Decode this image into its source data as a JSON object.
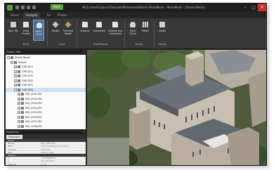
{
  "window": {
    "title": "W:\\ContextCapture\\Tutorials\\Photomesh\\Demo.PhotoMesh - PhotoMesh - [Street Model]",
    "ribbon_badge": "Build",
    "minimize": "–",
    "maximize": "□",
    "close": "×"
  },
  "tabs": [
    "Home",
    "Analysis",
    "Tie",
    "Photos"
  ],
  "ribbon": {
    "buttons": [
      {
        "label": "New Tile",
        "icon": "new-tile-icon"
      },
      {
        "label": "Build Project",
        "icon": "build-project-icon"
      },
      {
        "label": "Build Cloud",
        "icon": "build-cloud-icon",
        "active": true
      },
      {
        "label": "Model",
        "icon": "model-icon"
      },
      {
        "label": "Textured Model",
        "icon": "textured-model-icon"
      },
      {
        "label": "Original",
        "icon": "original-icon"
      },
      {
        "label": "Calculated",
        "icon": "calculated-icon"
      },
      {
        "label": "Original and Calculated",
        "icon": "original-calculated-icon"
      },
      {
        "label": "Point Cloud",
        "icon": "point-cloud-icon"
      },
      {
        "label": "Model",
        "icon": "export-model-icon"
      },
      {
        "label": "Model",
        "icon": "upload-model-icon"
      }
    ],
    "groups": [
      "Build",
      "Show",
      "Show Photos",
      "Export",
      "Upload"
    ]
  },
  "project_tree": {
    "header": "Project Tree",
    "close": "×",
    "items": [
      {
        "label": "Street Model",
        "level": 0,
        "expand": "-"
      },
      {
        "label": "Photos",
        "level": 1,
        "expand": "-"
      },
      {
        "label": "CAM [01]",
        "level": 2,
        "expand": "+"
      },
      {
        "label": "CAM [02]",
        "level": 2,
        "expand": "+"
      },
      {
        "label": "CAM [03]",
        "level": 2,
        "expand": "+"
      },
      {
        "label": "CAM [04]",
        "level": 2,
        "expand": "+"
      },
      {
        "label": "CAM [05]",
        "level": 2,
        "expand": "+"
      },
      {
        "label": "CAM [06]",
        "level": 2,
        "expand": "-",
        "selected": true
      },
      {
        "label": "IMG_0001.JPG",
        "level": 3,
        "expand": "+"
      },
      {
        "label": "IMG_0002.JPG",
        "level": 3,
        "expand": "+"
      },
      {
        "label": "IMG_0003.JPG",
        "level": 3,
        "expand": "+"
      },
      {
        "label": "IMG_0004.JPG",
        "level": 3,
        "expand": "+"
      },
      {
        "label": "IMG_0005.JPG",
        "level": 3,
        "expand": "+"
      },
      {
        "label": "IMG_0006.JPG",
        "level": 3,
        "expand": "+"
      },
      {
        "label": "IMG_0007.JPG",
        "level": 3,
        "expand": "+"
      },
      {
        "label": "IMG_0008.JPG",
        "level": 3,
        "expand": "+"
      }
    ]
  },
  "properties": {
    "header": "Properties",
    "close": "×",
    "tab": "Properties",
    "rows": [
      {
        "key": "Photo",
        "value": "",
        "section": true
      },
      {
        "key": "Name",
        "value": "IMG_0006.JPG"
      },
      {
        "key": "Path",
        "value": "W:\\ContextCapture\\Photos"
      },
      {
        "key": "Camera",
        "value": "CAM [06]"
      },
      {
        "key": "Size",
        "value": "5472 x 3648"
      },
      {
        "key": "Position",
        "value": "",
        "section": true
      },
      {
        "key": "X",
        "value": "-73.99368413"
      },
      {
        "key": "Y",
        "value": "40.73127421"
      },
      {
        "key": "Altitude",
        "value": "62.31"
      }
    ]
  },
  "colors": {
    "accent": "#5f9d3a",
    "selected_button": "#4a6f92",
    "close_button": "#c9342a",
    "tree_selection": "#cfe3f7"
  }
}
